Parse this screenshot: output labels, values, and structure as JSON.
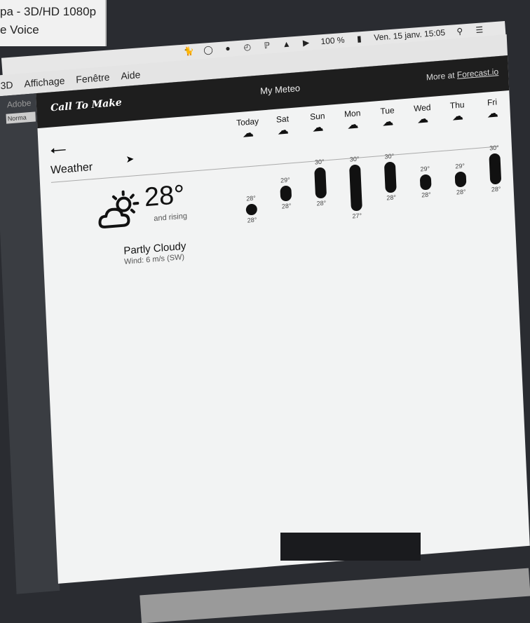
{
  "background_window": {
    "lines": [
      "pa - 3D/HD 1080p",
      "e Voice"
    ]
  },
  "system_menubar": {
    "battery": "100 %",
    "datetime": "Ven. 15 janv.  15:05",
    "icons": [
      "cat-icon",
      "glasses-icon",
      "hat-icon",
      "clock-icon",
      "bluetooth-icon",
      "wifi-icon",
      "volume-icon",
      "battery-icon",
      "search-icon",
      "list-icon"
    ]
  },
  "app_menubar": {
    "items": [
      "3D",
      "Affichage",
      "Fenêtre",
      "Aide"
    ]
  },
  "left_panel": {
    "title": "Adobe",
    "mode": "Norma"
  },
  "meteo": {
    "brand": "Call To Make",
    "title": "My Meteo",
    "link_prefix": "More at ",
    "link_text": "Forecast.io",
    "section_title": "Weather",
    "current": {
      "temp": "28°",
      "trend": "and rising",
      "condition": "Partly Cloudy",
      "wind": "Wind: 6 m/s (SW)"
    },
    "forecast": [
      {
        "day": "Today",
        "high": "28°",
        "low": "28°",
        "high_val": 28,
        "low_val": 28
      },
      {
        "day": "Sat",
        "high": "29°",
        "low": "28°",
        "high_val": 29,
        "low_val": 28
      },
      {
        "day": "Sun",
        "high": "30°",
        "low": "28°",
        "high_val": 30,
        "low_val": 28
      },
      {
        "day": "Mon",
        "high": "30°",
        "low": "27°",
        "high_val": 30,
        "low_val": 27
      },
      {
        "day": "Tue",
        "high": "30°",
        "low": "28°",
        "high_val": 30,
        "low_val": 28
      },
      {
        "day": "Wed",
        "high": "29°",
        "low": "28°",
        "high_val": 29,
        "low_val": 28
      },
      {
        "day": "Thu",
        "high": "29°",
        "low": "28°",
        "high_val": 29,
        "low_val": 28
      },
      {
        "day": "Fri",
        "high": "30°",
        "low": "28°",
        "high_val": 30,
        "low_val": 28
      }
    ]
  },
  "colors": {
    "header_bg": "#1e1e1e",
    "page_bg": "#f2f3f3",
    "bar": "#111111"
  }
}
